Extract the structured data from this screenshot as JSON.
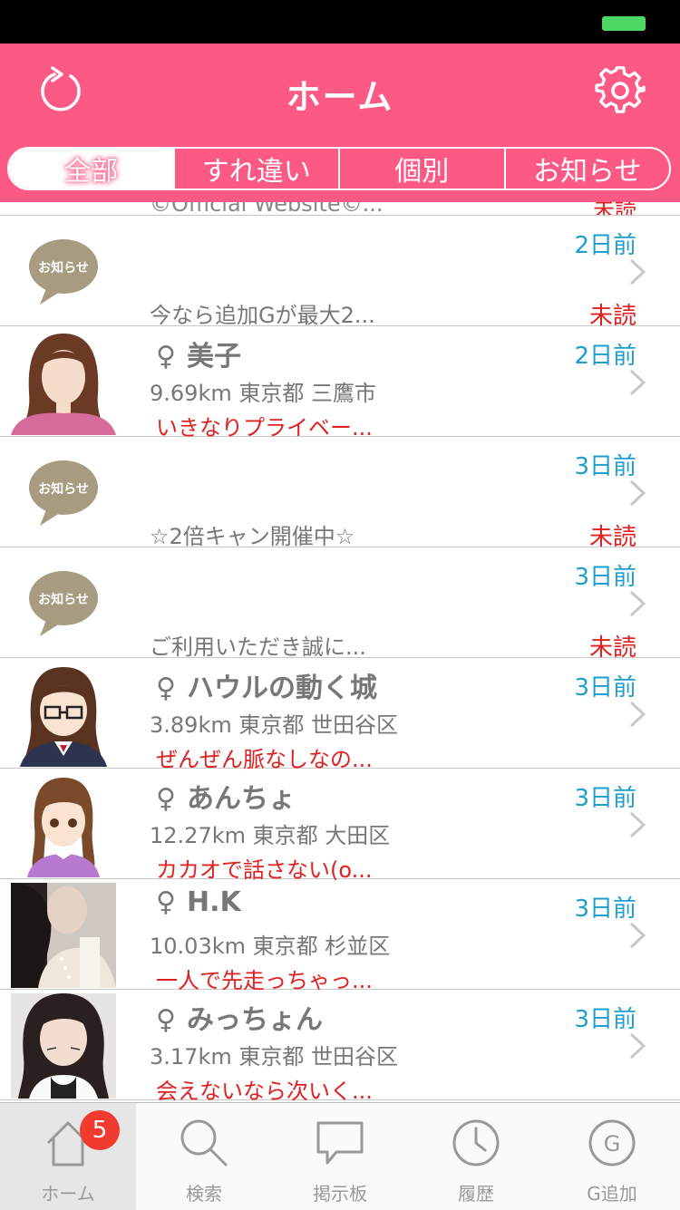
{
  "header": {
    "title": "ホーム"
  },
  "segments": [
    "全部",
    "すれ違い",
    "個別",
    "お知らせ"
  ],
  "cut_row": {
    "text": "©Official Website©...",
    "unread": "未読"
  },
  "rows": [
    {
      "time": "2日前",
      "notice": "今なら追加Gが最大2...",
      "unread": "未読",
      "bubble_label": "お知らせ"
    },
    {
      "time": "2日前",
      "gender": "♀",
      "name": "美子",
      "location": "9.69km  東京都 三鷹市",
      "message": "いきなりプライベー..."
    },
    {
      "time": "3日前",
      "notice": "☆2倍キャン開催中☆",
      "unread": "未読",
      "bubble_label": "お知らせ"
    },
    {
      "time": "3日前",
      "notice": "ご利用いただき誠に...",
      "unread": "未読",
      "bubble_label": "お知らせ"
    },
    {
      "time": "3日前",
      "gender": "♀",
      "name": "ハウルの動く城",
      "location": "3.89km  東京都 世田谷区",
      "message": "ぜんぜん脈なしなの..."
    },
    {
      "time": "3日前",
      "gender": "♀",
      "name": "あんちょ",
      "location": "12.27km  東京都 大田区",
      "message": "カカオで話さない(o..."
    },
    {
      "time": "3日前",
      "gender": "♀",
      "name": "H.K",
      "location": "10.03km  東京都 杉並区",
      "message": "一人で先走っちゃっ..."
    },
    {
      "time": "3日前",
      "gender": "♀",
      "name": "みっちょん",
      "location": "3.17km  東京都 世田谷区",
      "message": "会えないなら次いく..."
    }
  ],
  "tabbar": {
    "badge": "5",
    "tabs": [
      "ホーム",
      "検索",
      "掲示板",
      "履歴",
      "G追加"
    ]
  },
  "colors": {
    "brand": "#fc5a85",
    "time": "#1e9fd0",
    "unread": "#e02020"
  }
}
